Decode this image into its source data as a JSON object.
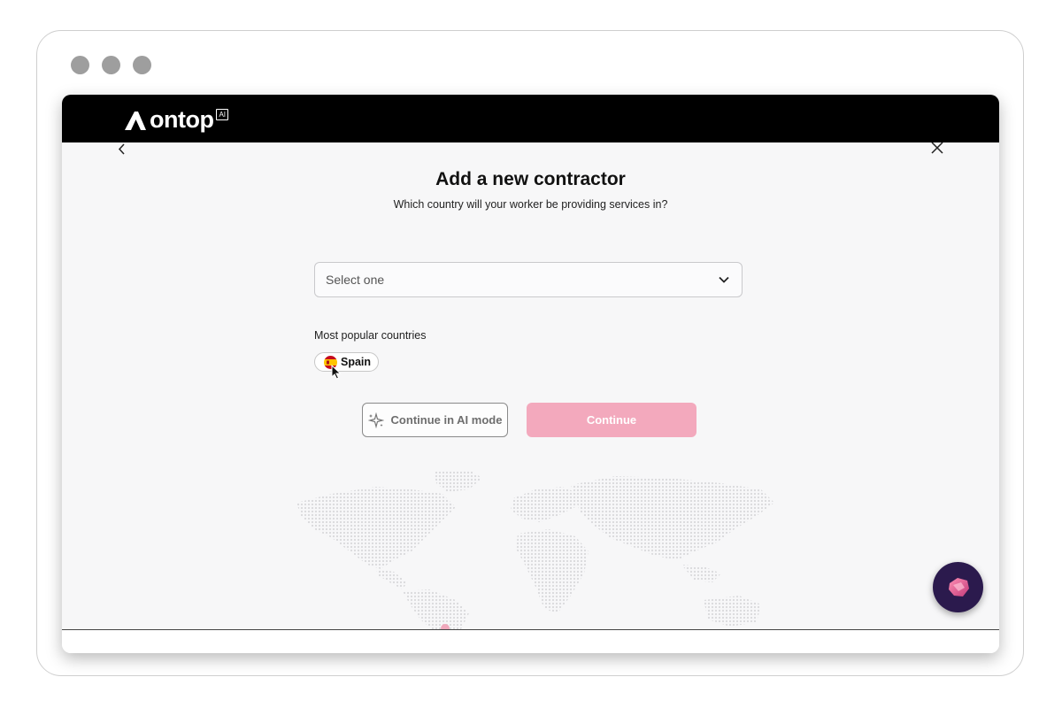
{
  "window": {
    "traffic_lights": [
      "close",
      "minimize",
      "maximize"
    ]
  },
  "header": {
    "logo_text": "ontop",
    "logo_badge": "AI"
  },
  "nav": {
    "back_icon": "chevron-left-icon",
    "close_icon": "close-icon"
  },
  "form": {
    "title": "Add a new contractor",
    "subtitle": "Which country will your worker be providing services in?",
    "country_select": {
      "placeholder": "Select one",
      "icon": "chevron-down-icon"
    },
    "popular_label": "Most popular countries",
    "popular_countries": [
      {
        "label": "Spain",
        "flag": "spain-flag-icon"
      }
    ]
  },
  "actions": {
    "ai_mode_label": "Continue in AI mode",
    "ai_mode_icon": "sparkle-icon",
    "continue_label": "Continue"
  },
  "colors": {
    "topbar": "#000000",
    "continue_button": "#f3a9bd",
    "chat_button": "#2b1a4d",
    "page_background": "#f7f7f8"
  },
  "chat_widget": {
    "icon": "chat-assistant-icon"
  }
}
